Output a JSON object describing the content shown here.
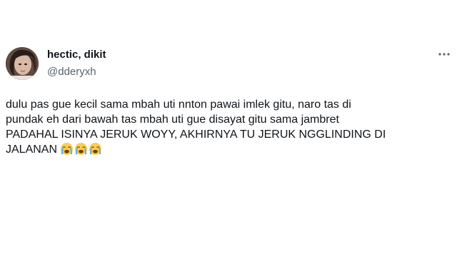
{
  "tweet": {
    "display_name": "hectic, dikit",
    "handle": "@dderyxh",
    "avatar_icon": "profile-photo",
    "more_icon": "more-horizontal-icon",
    "text_lines": [
      "dulu pas gue kecil sama mbah uti nnton pawai imlek gitu, naro tas di",
      "pundak eh dari bawah tas mbah uti gue disayat gitu sama jambret",
      "PADAHAL ISINYA JERUK WOYY, AKHIRNYA TU JERUK NGGLINDING DI",
      "JALANAN"
    ],
    "emojis": [
      "loudly-crying-face",
      "loudly-crying-face",
      "loudly-crying-face"
    ]
  },
  "colors": {
    "text_primary": "#0f1419",
    "text_secondary": "#536471",
    "background": "#ffffff"
  }
}
